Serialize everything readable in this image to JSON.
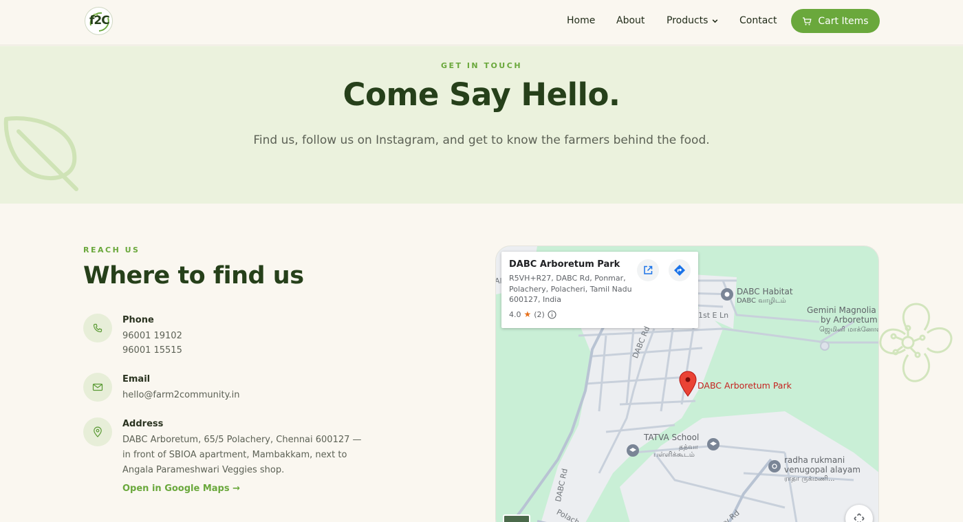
{
  "header": {
    "logo_text": "f2C",
    "nav": {
      "home": "Home",
      "about": "About",
      "products": "Products",
      "contact": "Contact"
    },
    "cart_label": "Cart Items"
  },
  "hero": {
    "eyebrow": "GET IN TOUCH",
    "title": "Come Say Hello.",
    "subtitle": "Find us, follow us on Instagram, and get to know the farmers behind the food."
  },
  "reach": {
    "eyebrow": "REACH US",
    "title": "Where to find us",
    "phone": {
      "label": "Phone",
      "numbers": [
        "96001 19102",
        "96001 15515"
      ]
    },
    "email": {
      "label": "Email",
      "value": "hello@farm2community.in"
    },
    "address": {
      "label": "Address",
      "value": "DABC Arboretum, 65/5 Polachery, Chennai 600127 — in front of SBIOA apartment, Mambakkam, next to Angala Parameshwari Veggies shop."
    },
    "maps_link": "Open in Google Maps →"
  },
  "map": {
    "card": {
      "title": "DABC Arboretum Park",
      "address": "R5VH+R27, DABC Rd, Ponmar, Polachery, Polacheri, Tamil Nadu 600127, India",
      "rating": "4.0",
      "reviews": "(2)"
    },
    "labels": {
      "habitat": "DABC Habitat",
      "habitat_ta": "DABC வாழிடம்",
      "first_e_ln": "1st E Ln",
      "gemini_1": "Gemini Magnolia",
      "gemini_2": "by Arboretum",
      "gemini_ta": "ஜெமினி மாக்னோலியா",
      "pin": "DABC Arboretum Park",
      "dabc_rd_1": "DABC Rd",
      "dabc_rd_2": "DABC Rd",
      "tatva": "TATVA School",
      "tatva_ta_1": "தத்வா",
      "tatva_ta_2": "பள்ளிக்கூடம்",
      "radha_1": "radha rukmani",
      "radha_2": "venugopal alayam",
      "radha_ta": "ராதா ருக்மணி...",
      "polachery": "Polacha",
      "ry_rd": "ry Rd",
      "edge_al": "Al"
    }
  },
  "colors": {
    "accent": "#6aa83c",
    "heading": "#26401a",
    "hero_bg": "#ebf2dd",
    "page_bg": "#faf7f0",
    "map_green": "#c8f0d8",
    "pin_red": "#ea4335"
  }
}
